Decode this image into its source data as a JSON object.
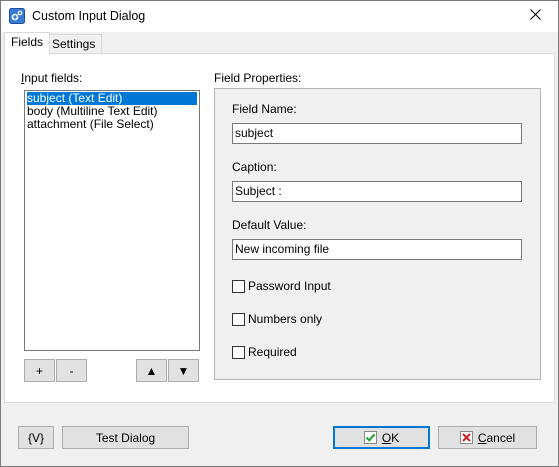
{
  "window": {
    "title": "Custom Input Dialog",
    "close_glyph": "✕",
    "icon": "app-icon"
  },
  "tabs": [
    {
      "label": "Fields",
      "active": true
    },
    {
      "label": "Settings",
      "active": false
    }
  ],
  "fields_panel": {
    "list_label": "Input fields:",
    "items": [
      {
        "label": "subject (Text Edit)",
        "selected": true
      },
      {
        "label": "body (Multiline Text Edit)",
        "selected": false
      },
      {
        "label": "attachment (File Select)",
        "selected": false
      }
    ],
    "add_label": "+",
    "remove_label": "-",
    "up_glyph": "▲",
    "down_glyph": "▼"
  },
  "properties": {
    "group_label": "Field Properties:",
    "field_name_label": "Field Name:",
    "field_name_value": "subject",
    "caption_label": "Caption:",
    "caption_value": "Subject :",
    "default_value_label": "Default Value:",
    "default_value_value": "New incoming file",
    "password_label": "Password Input",
    "password_checked": false,
    "numbers_label": "Numbers only",
    "numbers_checked": false,
    "required_label": "Required",
    "required_checked": false
  },
  "footer": {
    "variables_label": "{V}",
    "test_dialog_label": "Test Dialog",
    "ok_label": "OK",
    "cancel_label": "Cancel",
    "ok_icon_color": "#1a9f2a",
    "cancel_icon_color": "#d32020"
  },
  "colors": {
    "selection": "#0078d7",
    "window_bg": "#f0f0f0"
  }
}
